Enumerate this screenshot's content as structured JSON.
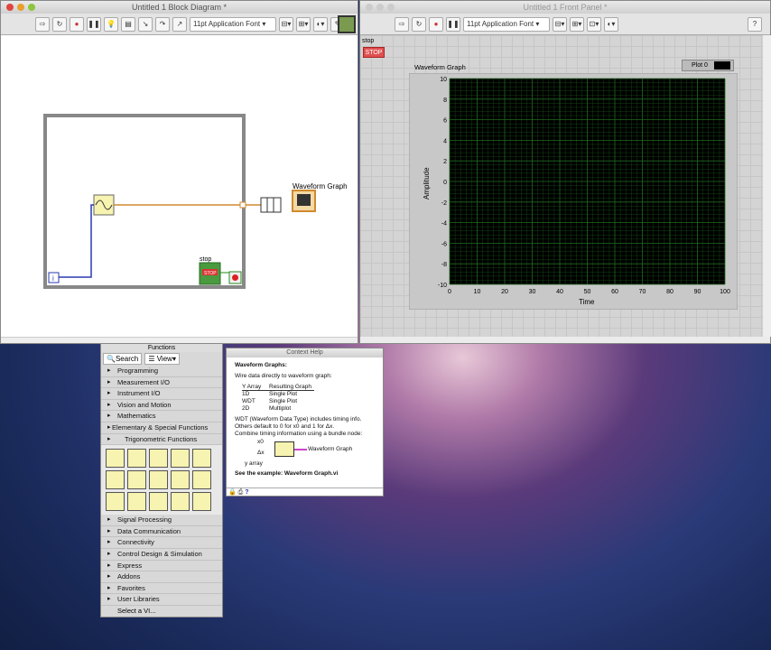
{
  "block_diagram": {
    "title": "Untitled 1 Block Diagram *",
    "font": "11pt Application Font",
    "graph_label": "Waveform Graph",
    "stop_label": "stop",
    "stop_text": "STOP",
    "iter": "i"
  },
  "front_panel": {
    "title": "Untitled 1 Front Panel *",
    "font": "11pt Application Font",
    "stop_label": "stop",
    "stop_button": "STOP",
    "graph_title": "Waveform Graph",
    "legend": "Plot 0",
    "y_label": "Amplitude",
    "x_label": "Time",
    "y_ticks": [
      "10",
      "8",
      "6",
      "4",
      "2",
      "0",
      "-2",
      "-4",
      "-6",
      "-8",
      "-10"
    ],
    "x_ticks": [
      "0",
      "10",
      "20",
      "30",
      "40",
      "50",
      "60",
      "70",
      "80",
      "90",
      "100"
    ],
    "plot_bg": "#000000",
    "grid_color": "#1f6a1f"
  },
  "functions": {
    "title": "Functions",
    "search": "Search",
    "view": "View",
    "top": [
      "Programming",
      "Measurement I/O",
      "Instrument I/O",
      "Vision and Motion",
      "Mathematics"
    ],
    "sub1": "Elementary & Special Functions",
    "sub2": "Trigonometric Functions",
    "bottom": [
      "Signal Processing",
      "Data Communication",
      "Connectivity",
      "Control Design & Simulation",
      "Express",
      "Addons",
      "Favorites",
      "User Libraries"
    ],
    "select": "Select a VI..."
  },
  "help": {
    "title": "Context Help",
    "heading": "Waveform Graphs:",
    "intro": "Wire data directly to waveform graph:",
    "col1": "Y Array",
    "col2": "Resulting Graph",
    "rows": [
      [
        "1D",
        "Single Plot"
      ],
      [
        "WDT",
        "Single Plot"
      ],
      [
        "2D",
        "Multiplot"
      ]
    ],
    "l1": "WDT (Waveform Data Type) includes timing info.",
    "l2": "Others default to 0 for x0 and 1 for Δx.",
    "l3": "Combine timing information using a bundle node:",
    "x0": "x0",
    "dx": "Δx",
    "yarr": "y array",
    "out": "Waveform Graph",
    "example": "See the example: Waveform Graph.vi"
  }
}
